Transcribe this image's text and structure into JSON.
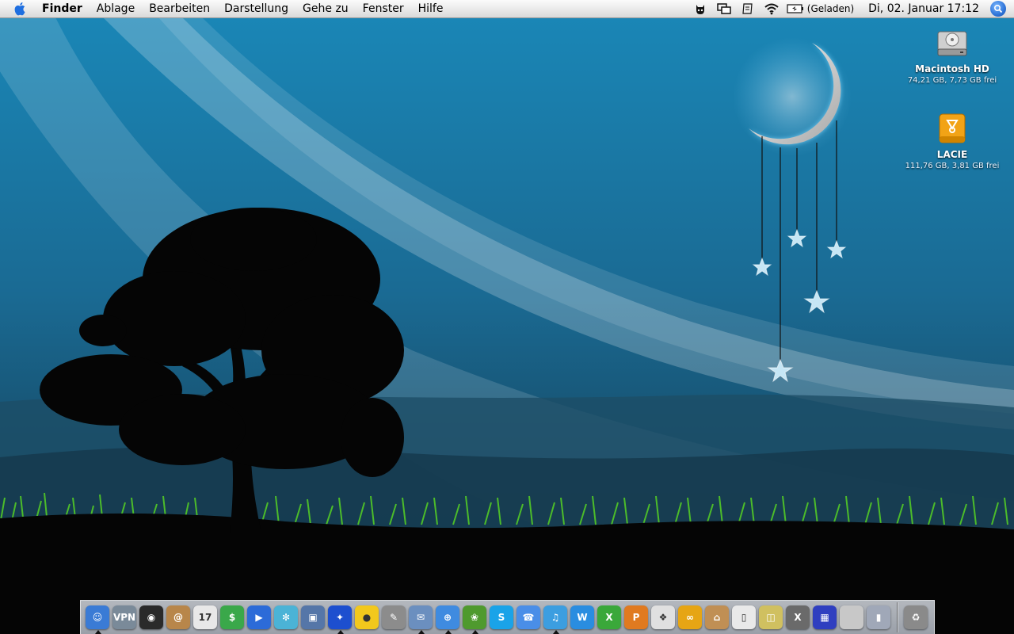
{
  "menubar": {
    "app_name": "Finder",
    "items": [
      "Ablage",
      "Bearbeiten",
      "Darstellung",
      "Gehe zu",
      "Fenster",
      "Hilfe"
    ],
    "battery_status": "(Geladen)",
    "clock": "Di, 02. Januar 17:12",
    "status_icons": [
      "cat-agent-icon",
      "spaces-icon",
      "script-icon",
      "wifi-icon",
      "battery-icon"
    ]
  },
  "desktop": {
    "volumes": [
      {
        "name": "Macintosh HD",
        "info": "74,21 GB, 7,73 GB frei",
        "icon": "hard-drive-icon"
      },
      {
        "name": "LACIE",
        "info": "111,76 GB, 3,81 GB frei",
        "icon": "firewire-drive-icon"
      }
    ]
  },
  "dock": {
    "apps": [
      {
        "icon": "finder-icon",
        "label": "☺",
        "color": "#3a7bd5",
        "running": true
      },
      {
        "icon": "vpn-icon",
        "label": "VPN",
        "color": "#7a8a99",
        "running": false
      },
      {
        "icon": "camera-lens-icon",
        "label": "◉",
        "color": "#2a2a2a",
        "running": false
      },
      {
        "icon": "address-book-icon",
        "label": "@",
        "color": "#b8864a",
        "running": false
      },
      {
        "icon": "ical-icon",
        "label": "17",
        "color": "#e8e8e8",
        "running": false
      },
      {
        "icon": "money-icon",
        "label": "$",
        "color": "#3aa84a",
        "running": false
      },
      {
        "icon": "clapper-icon",
        "label": "▶",
        "color": "#2c6bd8",
        "running": false
      },
      {
        "icon": "snow-globe-icon",
        "label": "✻",
        "color": "#4bb3d6",
        "running": false
      },
      {
        "icon": "screen-icon",
        "label": "▣",
        "color": "#5576a8",
        "running": false
      },
      {
        "icon": "blue-frog-icon",
        "label": "✦",
        "color": "#1d4fcf",
        "running": true
      },
      {
        "icon": "rubber-duck-icon",
        "label": "●",
        "color": "#f2c81c",
        "running": false
      },
      {
        "icon": "quill-icon",
        "label": "✎",
        "color": "#8c8c8c",
        "running": false
      },
      {
        "icon": "mail-icon",
        "label": "✉",
        "color": "#6b8fbf",
        "running": true
      },
      {
        "icon": "safari-icon",
        "label": "⊕",
        "color": "#3f8be0",
        "running": true
      },
      {
        "icon": "adium-icon",
        "label": "❀",
        "color": "#4f9a2e",
        "running": true
      },
      {
        "icon": "skype-icon",
        "label": "S",
        "color": "#1aa3e8",
        "running": false
      },
      {
        "icon": "ichat-icon",
        "label": "☎",
        "color": "#4a8ee8",
        "running": false
      },
      {
        "icon": "itunes-icon",
        "label": "♫",
        "color": "#3c9ee0",
        "running": true
      },
      {
        "icon": "word-icon",
        "label": "W",
        "color": "#2a8de0",
        "running": false
      },
      {
        "icon": "excel-icon",
        "label": "X",
        "color": "#3aa83a",
        "running": false
      },
      {
        "icon": "powerpoint-icon",
        "label": "P",
        "color": "#e07a20",
        "running": false
      },
      {
        "icon": "photo-icon",
        "label": "❖",
        "color": "#e0e0e0",
        "running": false
      },
      {
        "icon": "office-icon",
        "label": "∞",
        "color": "#e6a514",
        "running": false
      },
      {
        "icon": "bucket-icon",
        "label": "⌂",
        "color": "#c08f54",
        "running": false
      },
      {
        "icon": "remote-icon",
        "label": "▯",
        "color": "#e9e9e9",
        "running": false
      },
      {
        "icon": "preview-icon",
        "label": "◫",
        "color": "#d0c060",
        "running": false
      },
      {
        "icon": "x11-icon",
        "label": "X",
        "color": "#6a6a6a",
        "running": false
      },
      {
        "icon": "spaces-app-icon",
        "label": "▦",
        "color": "#2f3fc0",
        "running": false
      },
      {
        "icon": "system-prefs-icon",
        "label": "",
        "color": "#c8c8c8",
        "running": false
      },
      {
        "icon": "stack-icon",
        "label": "▮",
        "color": "#a0a8b8",
        "running": false
      }
    ],
    "trash": {
      "icon": "trash-icon",
      "label": "♻",
      "color": "#8a8a8a"
    }
  }
}
